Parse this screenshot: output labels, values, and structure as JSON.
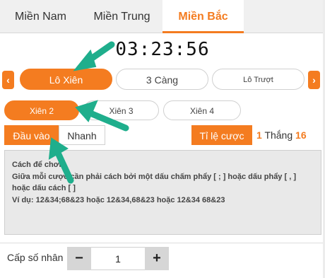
{
  "region_tabs": [
    {
      "label": "Miền Nam",
      "active": false
    },
    {
      "label": "Miền Trung",
      "active": false
    },
    {
      "label": "Miền Bắc",
      "active": true
    }
  ],
  "clock": "03:23:56",
  "bet_types": [
    {
      "label": "Lô Xiên",
      "active": true
    },
    {
      "label": "3 Càng",
      "active": false
    },
    {
      "label": "Lô Trượt",
      "active": false
    }
  ],
  "nav": {
    "prev_icon": "chevron-left-icon",
    "next_icon": "chevron-right-icon"
  },
  "xien_types": [
    {
      "label": "Xiên 2",
      "active": true
    },
    {
      "label": "Xiên 3",
      "active": false
    },
    {
      "label": "Xiên 4",
      "active": false
    }
  ],
  "input_modes": [
    {
      "label": "Đầu vào",
      "active": true
    },
    {
      "label": "Nhanh",
      "active": false
    }
  ],
  "rate": {
    "label": "Tỉ lệ cược",
    "left_value": "1",
    "text": "Thắng",
    "right_value": "16"
  },
  "instructions": {
    "line1": "Cách để chơi",
    "line2": "Giữa mỗi cược cần phải cách bởi một dấu chấm phẩy [ ; ] hoặc dấu phẩy [ , ]",
    "line3": "hoặc dấu cách [ ]",
    "line4": "Ví dụ: 12&34;68&23 hoặc 12&34,68&23 hoặc 12&34 68&23"
  },
  "multiplier": {
    "label": "Cấp số nhân",
    "minus": "−",
    "value": "1",
    "plus": "+"
  },
  "colors": {
    "accent": "#f47c20",
    "annotation_arrow": "#1fae8c"
  }
}
